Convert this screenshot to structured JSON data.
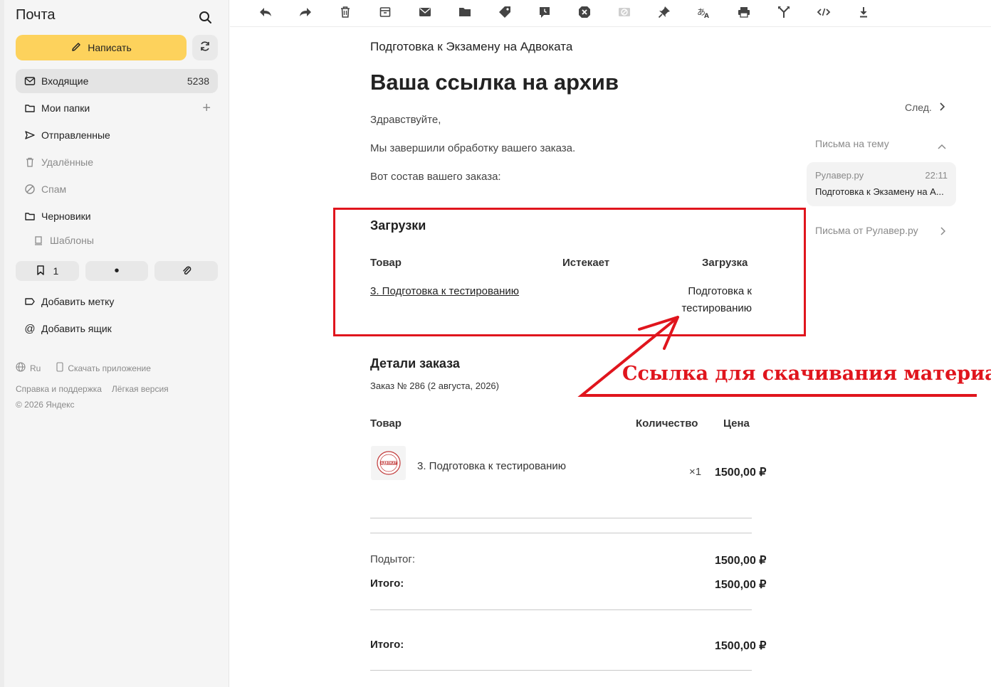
{
  "app": {
    "title": "Почта"
  },
  "sidebar": {
    "compose_label": "Написать",
    "folders": [
      {
        "label": "Входящие",
        "count": "5238"
      },
      {
        "label": "Мои папки"
      },
      {
        "label": "Отправленные"
      },
      {
        "label": "Удалённые"
      },
      {
        "label": "Спам"
      },
      {
        "label": "Черновики"
      },
      {
        "label": "Шаблоны"
      }
    ],
    "chips": {
      "bookmark_count": "1",
      "unread_dot": "•"
    },
    "add_label": "Добавить метку",
    "add_mailbox": "Добавить ящик",
    "footer": {
      "lang": "Ru",
      "download_app": "Скачать приложение",
      "help": "Справка и поддержка",
      "lite": "Лёгкая версия",
      "copyright": "© 2026 Яндекс"
    }
  },
  "toolbar": {
    "icons": [
      "reply-icon",
      "forward-icon",
      "delete-icon",
      "archive-icon",
      "mark-read-icon",
      "move-to-folder-icon",
      "label-icon",
      "reminder-icon",
      "spam-icon",
      "unsubscribe-icon",
      "pin-icon",
      "translate-icon",
      "print-icon",
      "split-icon",
      "source-code-icon",
      "download-icon"
    ]
  },
  "email": {
    "subject_line": "Подготовка к Экзамену на Адвоката",
    "title": "Ваша ссылка на архив",
    "greeting": "Здравствуйте,",
    "line1": "Мы завершили обработку вашего заказа.",
    "line2": "Вот состав вашего заказа:",
    "downloads": {
      "heading": "Загрузки",
      "col_product": "Товар",
      "col_expires": "Истекает",
      "col_download": "Загрузка",
      "product_link": "3. Подготовка к тестированию",
      "download_link_l1": "Подготовка к",
      "download_link_l2": "тестированию"
    },
    "order": {
      "heading": "Детали заказа",
      "meta": "Заказ № 286 (2 августа, 2026)",
      "col_product": "Товар",
      "col_qty": "Количество",
      "col_price": "Цена",
      "item_name": "3. Подготовка к тестированию",
      "item_qty": "×1",
      "item_price": "1500,00 ₽",
      "subtotal_label": "Подытог:",
      "subtotal_value": "1500,00 ₽",
      "total_label": "Итого:",
      "total_value": "1500,00 ₽",
      "total2_label": "Итого:",
      "total2_value": "1500,00 ₽",
      "thumb_text": "АДВОКАТ"
    }
  },
  "right_panel": {
    "next_label": "След.",
    "thread_label": "Письма на тему",
    "thread_item": {
      "sender": "Рулавер.ру",
      "time": "22:11",
      "subject": "Подготовка к Экзамену на А..."
    },
    "from_sender_label": "Письма от Рулавер.ру"
  },
  "annotation": {
    "text": "Ссылка для скачивания материалов"
  },
  "colors": {
    "accent": "#fdd25c",
    "annotation_red": "#e0151d"
  }
}
